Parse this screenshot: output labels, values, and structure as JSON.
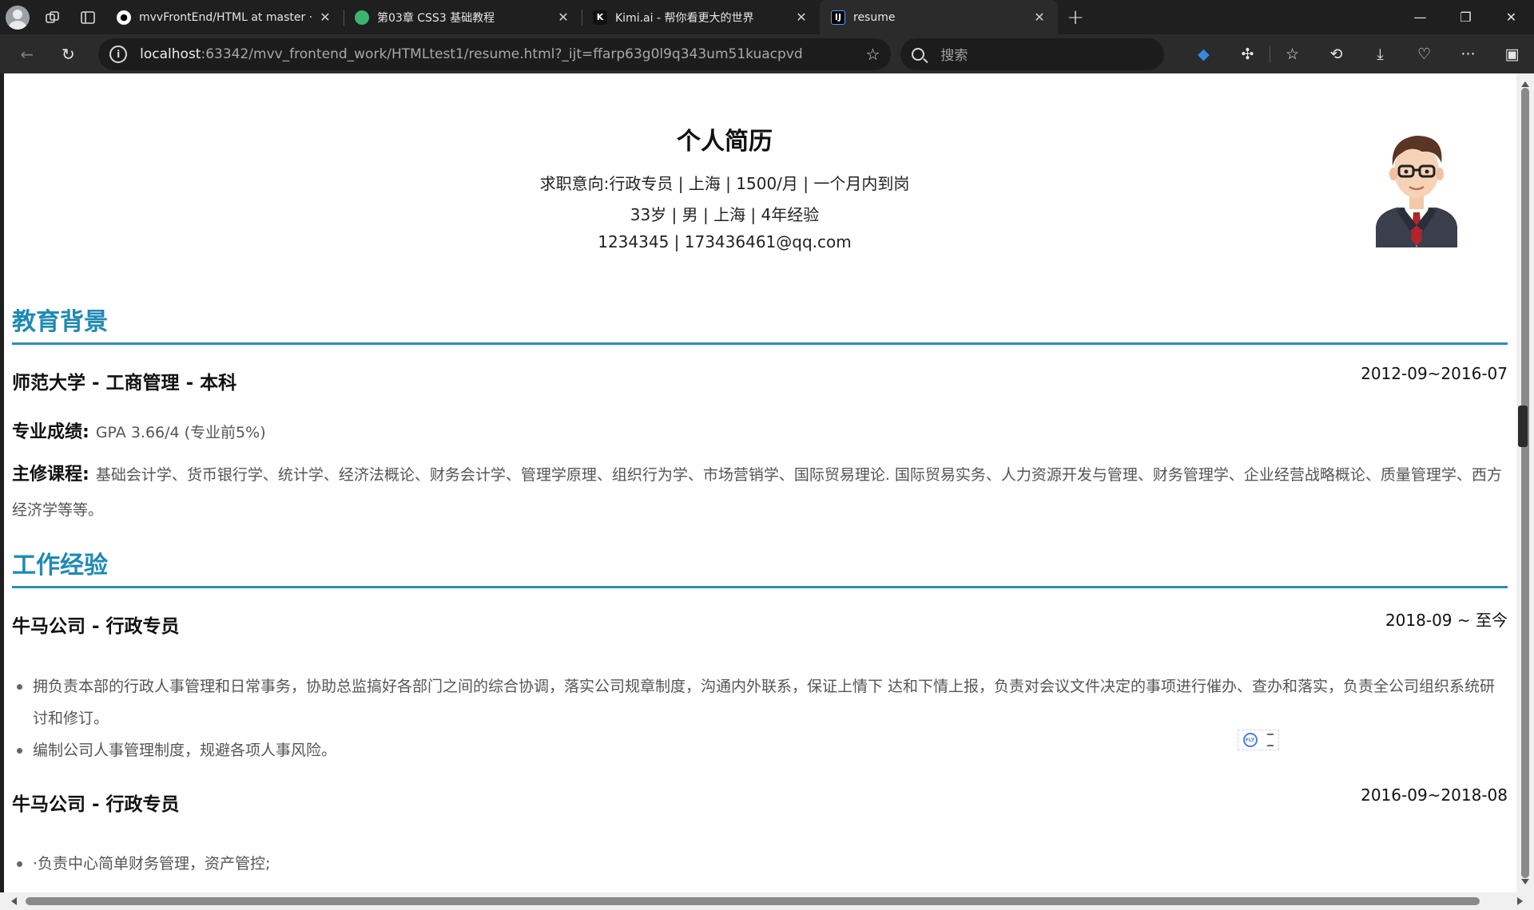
{
  "browser": {
    "tabs": [
      {
        "title": "mvvFrontEnd/HTML at master · q",
        "icon": "github-icon",
        "active": false
      },
      {
        "title": "第03章 CSS3 基础教程",
        "icon": "green-drop-icon",
        "active": false
      },
      {
        "title": "Kimi.ai - 帮你看更大的世界",
        "icon": "kimi-icon",
        "active": false
      },
      {
        "title": "resume",
        "icon": "intellij-icon",
        "active": true
      }
    ],
    "address": {
      "host": "localhost",
      "path": ":63342/mvv_frontend_work/HTMLtest1/resume.html?_ijt=ffarp63g0l9q343um51kuacpvd"
    },
    "search_placeholder": "搜索"
  },
  "resume": {
    "name": "个人简历",
    "intent": "求职意向:行政专员 | 上海 | 1500/月 | 一个月内到岗",
    "basic": "33岁 | 男 | 上海 | 4年经验",
    "contact": "1234345  | 173436461@qq.com",
    "education": {
      "heading": "教育背景",
      "title": "师范大学 - 工商管理 - 本科",
      "date": "2012-09~2016-07",
      "gpa_label": "专业成绩:",
      "gpa_value": "GPA 3.66/4 (专业前5%)",
      "courses_label": "主修课程:",
      "courses_value": "基础会计学、货币银行学、统计学、经济法概论、财务会计学、管理学原理、组织行为学、市场营销学、国际贸易理论. 国际贸易实务、人力资源开发与管理、财务管理学、企业经营战略概论、质量管理学、西方经济学等等。"
    },
    "work": {
      "heading": "工作经验",
      "jobs": [
        {
          "title": "牛马公司 - 行政专员",
          "date": "2018-09 ~ 至今",
          "duties": [
            "拥负责本部的行政人事管理和日常事务，协助总监搞好各部门之间的综合协调，落实公司规章制度，沟通内外联系，保证上情下 达和下情上报，负责对会议文件决定的事项进行催办、查办和落实，负责全公司组织系统研讨和修订。",
            "编制公司人事管理制度，规避各项人事风险。"
          ]
        },
        {
          "title": "牛马公司 - 行政专员",
          "date": "2016-09~2018-08",
          "duties": [
            "·负责中心简单财务管理，资产管控;"
          ]
        }
      ]
    },
    "accent_color": "#1f8ab3"
  }
}
